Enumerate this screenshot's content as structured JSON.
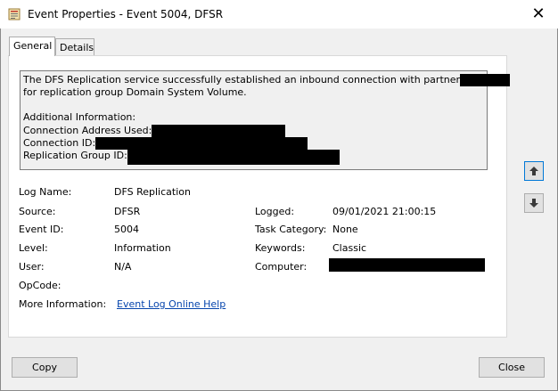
{
  "window": {
    "title": "Event Properties - Event 5004, DFSR"
  },
  "tabs": [
    {
      "label": "General"
    },
    {
      "label": "Details"
    }
  ],
  "description": {
    "line1": "The DFS Replication service successfully established an inbound connection with partner",
    "line2": "for replication group Domain System Volume.",
    "additional_info": "Additional Information:",
    "connection_address_label": "Connection Address Used:",
    "connection_id_label": "Connection ID:",
    "replication_group_id_label": "Replication Group ID:"
  },
  "fields": {
    "log_name": {
      "label": "Log Name:",
      "value": "DFS Replication"
    },
    "source": {
      "label": "Source:",
      "value": "DFSR"
    },
    "event_id": {
      "label": "Event ID:",
      "value": "5004"
    },
    "level": {
      "label": "Level:",
      "value": "Information"
    },
    "user": {
      "label": "User:",
      "value": "N/A"
    },
    "opcode": {
      "label": "OpCode:",
      "value": ""
    },
    "more_info": {
      "label": "More Information:",
      "value": "Event Log Online Help"
    },
    "logged": {
      "label": "Logged:",
      "value": "09/01/2021 21:00:15"
    },
    "task_category": {
      "label": "Task Category:",
      "value": "None"
    },
    "keywords": {
      "label": "Keywords:",
      "value": "Classic"
    },
    "computer": {
      "label": "Computer:",
      "value": ""
    }
  },
  "buttons": {
    "copy": "Copy",
    "close": "Close"
  },
  "icons": {
    "window": "event-viewer-icon",
    "close": "close-icon",
    "up": "arrow-up-icon",
    "down": "arrow-down-icon"
  },
  "colors": {
    "link": "#0645ad",
    "focus_border": "#0078d7",
    "redaction": "#000000"
  }
}
